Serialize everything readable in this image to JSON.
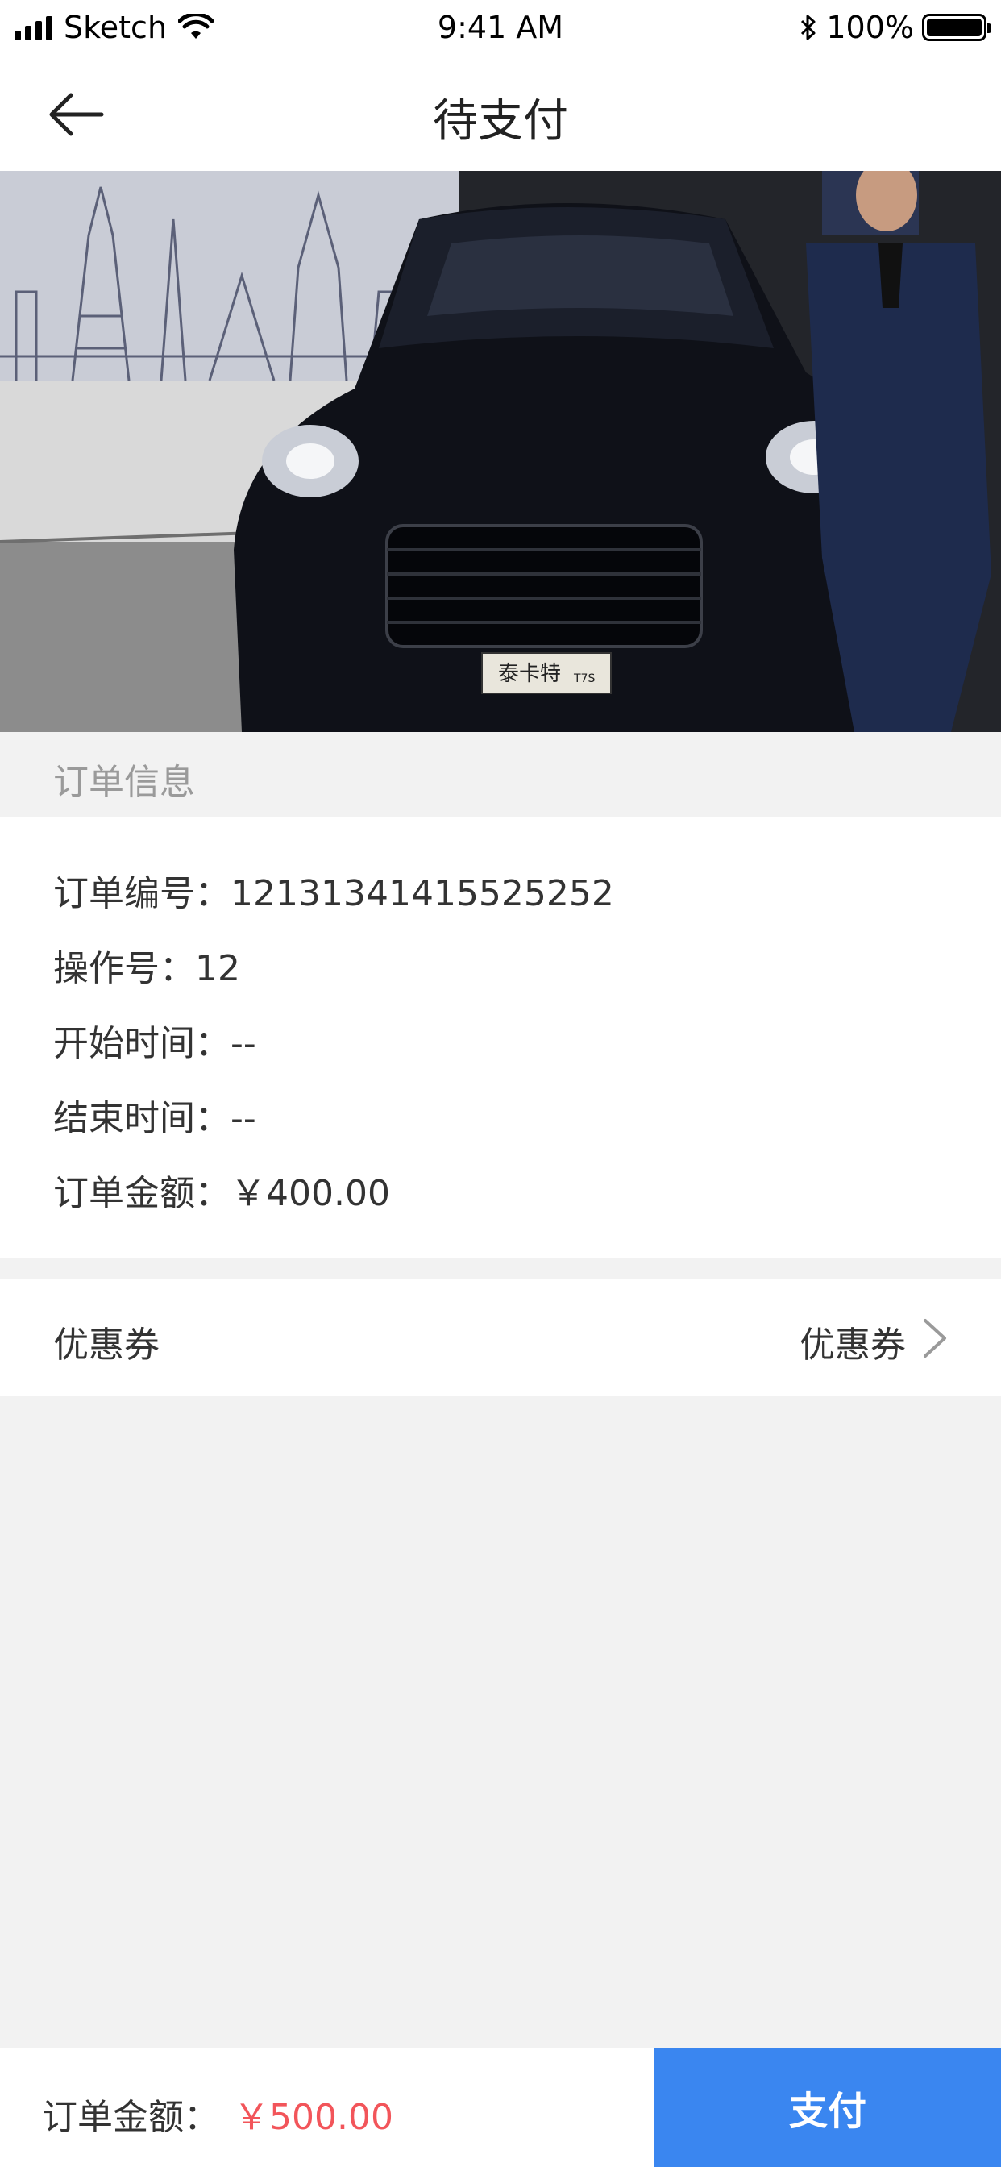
{
  "status_bar": {
    "carrier": "Sketch",
    "time": "9:41 AM",
    "battery": "100%",
    "battery_level": 1.0,
    "icons": [
      "signal-icon",
      "wifi-icon",
      "bluetooth-icon",
      "battery-icon"
    ]
  },
  "nav": {
    "title": "待支付",
    "back_icon": "back-arrow-icon"
  },
  "hero": {
    "plate_text": "泰卡特",
    "plate_sub": "T7S"
  },
  "order_section": {
    "title": "订单信息",
    "order_no_label": "订单编号：",
    "order_no_value": "12131341415525252",
    "operation_no_label": "操作号：",
    "operation_no_value": "12",
    "start_time_label": "开始时间：",
    "start_time_value": "--",
    "end_time_label": "结束时间：",
    "end_time_value": "--",
    "amount_label": "订单金额：",
    "amount_value": "￥400.00"
  },
  "coupon": {
    "label": "优惠券",
    "value": "优惠券",
    "icon": "chevron-right-icon"
  },
  "footer": {
    "total_label": "订单金额：",
    "total_value": "￥500.00",
    "pay_label": "支付"
  },
  "colors": {
    "accent": "#3a86f0",
    "price": "#f2555a",
    "background": "#f2f2f2"
  }
}
